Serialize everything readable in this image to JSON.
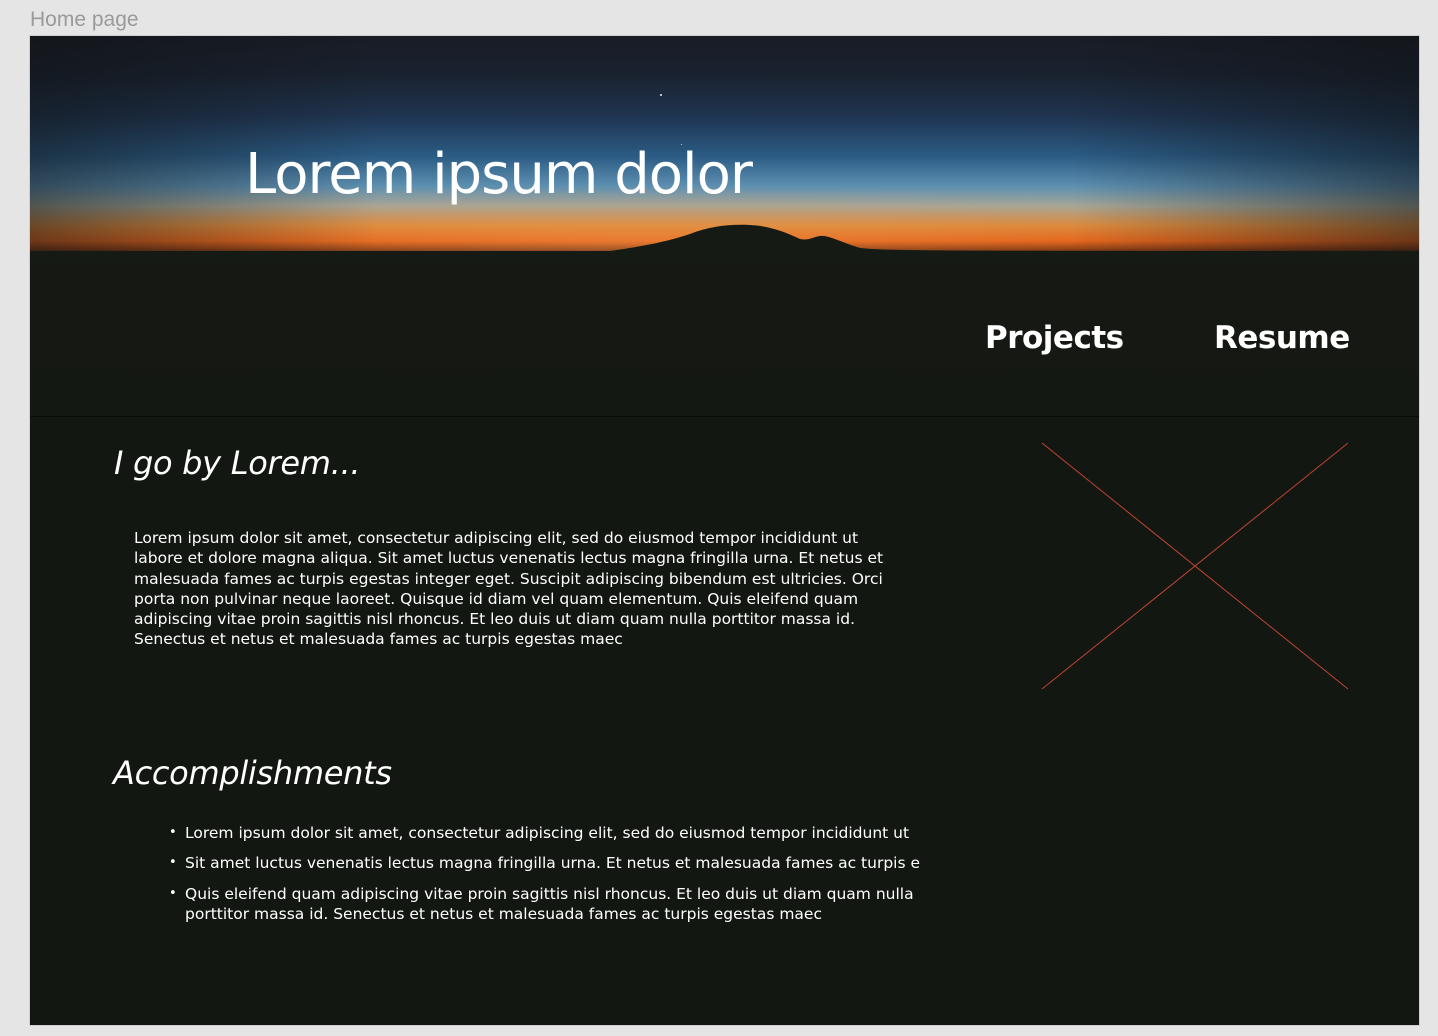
{
  "frame": {
    "label": "Home page"
  },
  "hero": {
    "title": "Lorem ipsum dolor",
    "background_image": "sunset-mountain-silhouette",
    "nav": [
      {
        "label": "Projects"
      },
      {
        "label": "Resume"
      }
    ]
  },
  "about": {
    "heading": "I go by Lorem...",
    "body": "Lorem ipsum dolor sit amet, consectetur adipiscing elit, sed do eiusmod tempor incididunt ut labore et dolore magna aliqua. Sit amet luctus venenatis lectus magna fringilla urna. Et netus et malesuada fames ac turpis egestas integer eget. Suscipit adipiscing bibendum est ultricies. Orci porta non pulvinar neque laoreet. Quisque id diam vel quam elementum. Quis eleifend quam adipiscing vitae proin sagittis nisl rhoncus. Et leo duis ut diam quam nulla porttitor massa id. Senectus et netus et malesuada fames ac turpis egestas maec",
    "image_placeholder": "image-placeholder-icon"
  },
  "accomplishments": {
    "heading": "Accomplishments",
    "items": [
      "Lorem ipsum dolor sit amet, consectetur adipiscing elit, sed do eiusmod tempor incididunt ut",
      "Sit amet luctus venenatis lectus magna fringilla urna. Et netus et malesuada fames ac turpis e",
      "Quis eleifend quam adipiscing vitae proin sagittis nisl rhoncus. Et leo duis ut diam quam nulla porttitor massa id. Senectus et netus et malesuada fames ac turpis egestas maec"
    ]
  },
  "colors": {
    "page_background": "#131712",
    "canvas_background": "#e5e5e5",
    "frame_label": "#9a9a9a",
    "text": "#ffffff",
    "placeholder_stroke": "#c0432f"
  }
}
